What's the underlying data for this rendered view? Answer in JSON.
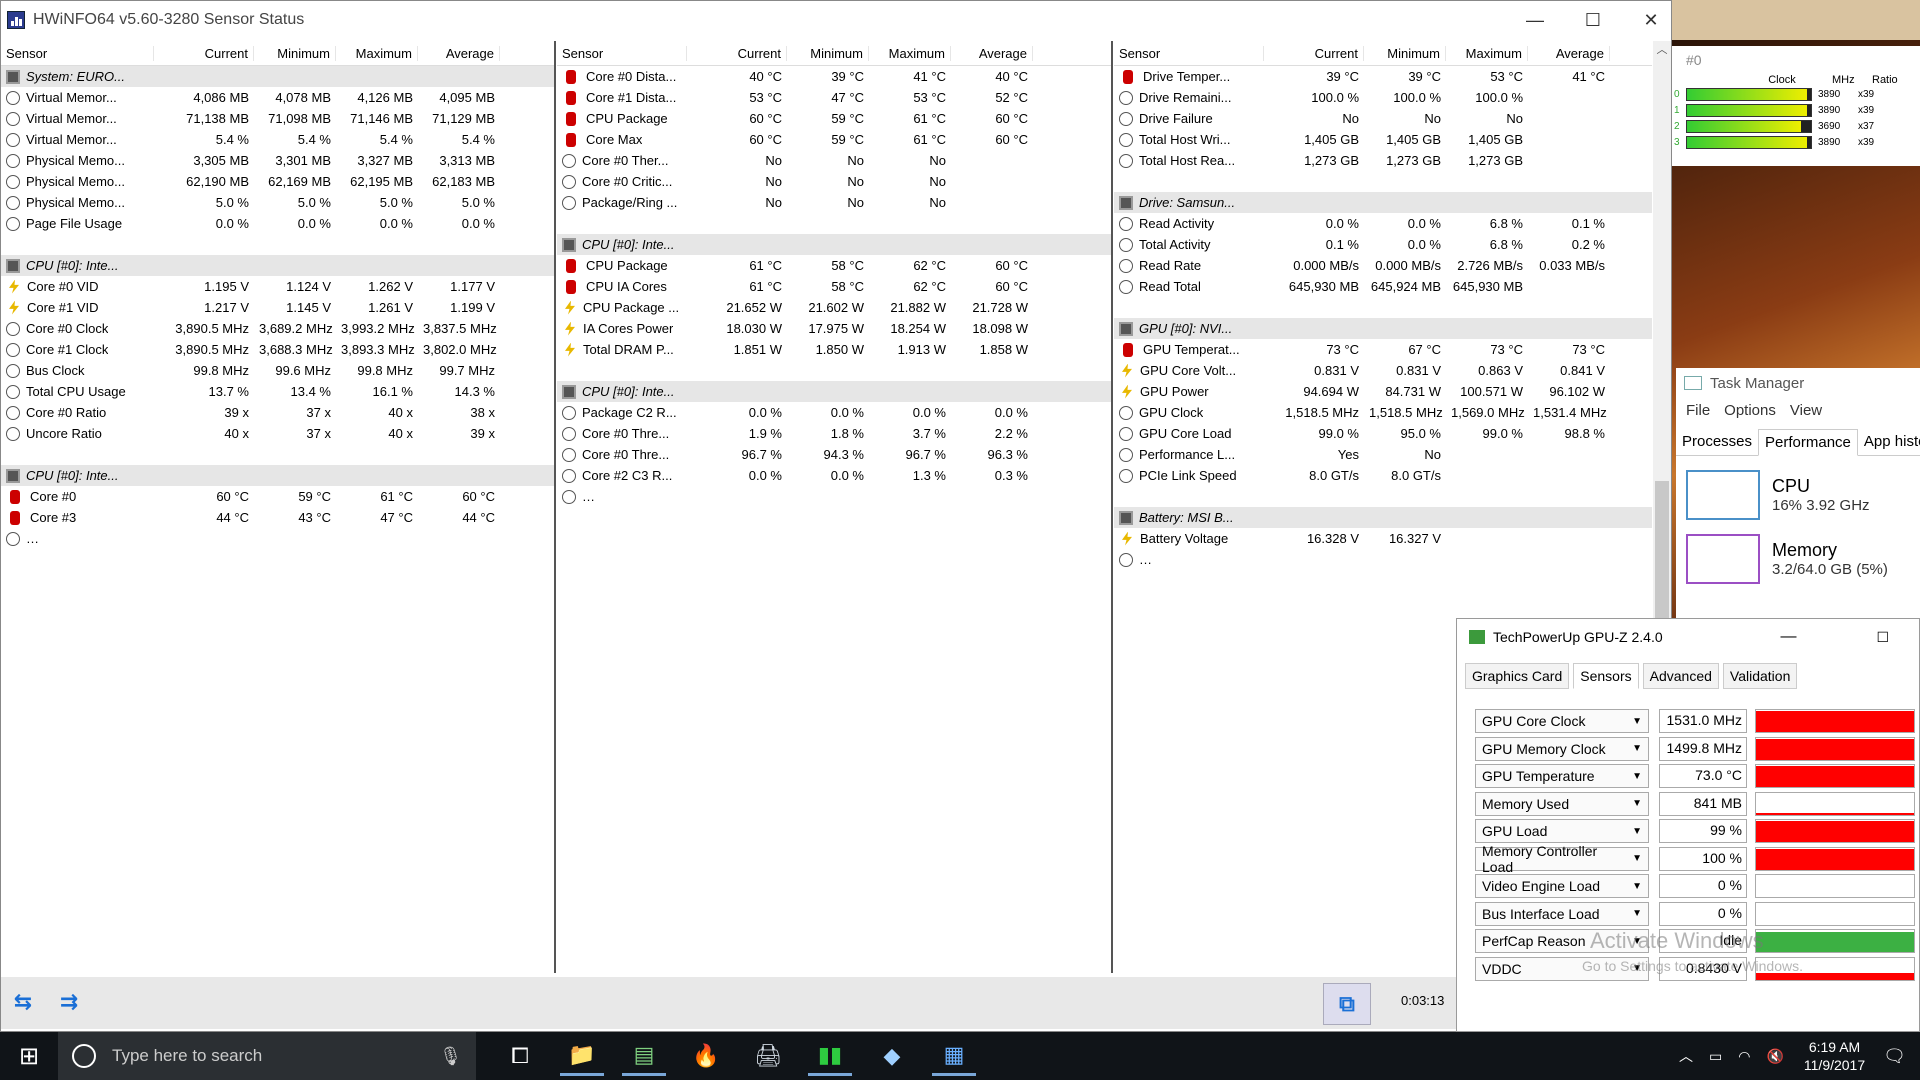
{
  "window": {
    "title": "HWiNFO64 v5.60-3280 Sensor Status",
    "min": "—",
    "max": "☐",
    "close": "✕"
  },
  "columns": [
    "Sensor",
    "Current",
    "Minimum",
    "Maximum",
    "Average"
  ],
  "panel1": [
    {
      "g": "System: EURO..."
    },
    {
      "i": "clock",
      "c": [
        "Virtual Memor...",
        "4,086 MB",
        "4,078 MB",
        "4,126 MB",
        "4,095 MB"
      ]
    },
    {
      "i": "clock",
      "c": [
        "Virtual Memor...",
        "71,138 MB",
        "71,098 MB",
        "71,146 MB",
        "71,129 MB"
      ]
    },
    {
      "i": "clock",
      "c": [
        "Virtual Memor...",
        "5.4 %",
        "5.4 %",
        "5.4 %",
        "5.4 %"
      ]
    },
    {
      "i": "clock",
      "c": [
        "Physical Memo...",
        "3,305 MB",
        "3,301 MB",
        "3,327 MB",
        "3,313 MB"
      ]
    },
    {
      "i": "clock",
      "c": [
        "Physical Memo...",
        "62,190 MB",
        "62,169 MB",
        "62,195 MB",
        "62,183 MB"
      ]
    },
    {
      "i": "clock",
      "c": [
        "Physical Memo...",
        "5.0 %",
        "5.0 %",
        "5.0 %",
        "5.0 %"
      ]
    },
    {
      "i": "clock",
      "c": [
        "Page File Usage",
        "0.0 %",
        "0.0 %",
        "0.0 %",
        "0.0 %"
      ]
    },
    {
      "b": 1
    },
    {
      "g": "CPU [#0]: Inte..."
    },
    {
      "i": "volt",
      "c": [
        "Core #0 VID",
        "1.195 V",
        "1.124 V",
        "1.262 V",
        "1.177 V"
      ]
    },
    {
      "i": "volt",
      "c": [
        "Core #1 VID",
        "1.217 V",
        "1.145 V",
        "1.261 V",
        "1.199 V"
      ]
    },
    {
      "i": "clock",
      "c": [
        "Core #0 Clock",
        "3,890.5 MHz",
        "3,689.2 MHz",
        "3,993.2 MHz",
        "3,837.5 MHz"
      ]
    },
    {
      "i": "clock",
      "c": [
        "Core #1 Clock",
        "3,890.5 MHz",
        "3,688.3 MHz",
        "3,893.3 MHz",
        "3,802.0 MHz"
      ]
    },
    {
      "i": "clock",
      "c": [
        "Bus Clock",
        "99.8 MHz",
        "99.6 MHz",
        "99.8 MHz",
        "99.7 MHz"
      ]
    },
    {
      "i": "clock",
      "c": [
        "Total CPU Usage",
        "13.7 %",
        "13.4 %",
        "16.1 %",
        "14.3 %"
      ]
    },
    {
      "i": "clock",
      "c": [
        "Core #0 Ratio",
        "39 x",
        "37 x",
        "40 x",
        "38 x"
      ]
    },
    {
      "i": "clock",
      "c": [
        "Uncore Ratio",
        "40 x",
        "37 x",
        "40 x",
        "39 x"
      ]
    },
    {
      "b": 1
    },
    {
      "g": "CPU [#0]: Inte..."
    },
    {
      "i": "therm",
      "c": [
        "Core #0",
        "60 °C",
        "59 °C",
        "61 °C",
        "60 °C"
      ]
    },
    {
      "i": "therm",
      "c": [
        "Core #3",
        "44 °C",
        "43 °C",
        "47 °C",
        "44 °C"
      ]
    },
    {
      "i": "clock",
      "c": [
        "…",
        "",
        "",
        "",
        ""
      ]
    }
  ],
  "panel2": [
    {
      "i": "therm",
      "c": [
        "Core #0 Dista...",
        "40 °C",
        "39 °C",
        "41 °C",
        "40 °C"
      ]
    },
    {
      "i": "therm",
      "c": [
        "Core #1 Dista...",
        "53 °C",
        "47 °C",
        "53 °C",
        "52 °C"
      ]
    },
    {
      "i": "therm",
      "c": [
        "CPU Package",
        "60 °C",
        "59 °C",
        "61 °C",
        "60 °C"
      ]
    },
    {
      "i": "therm",
      "c": [
        "Core Max",
        "60 °C",
        "59 °C",
        "61 °C",
        "60 °C"
      ]
    },
    {
      "i": "clock",
      "c": [
        "Core #0 Ther...",
        "No",
        "No",
        "No",
        ""
      ]
    },
    {
      "i": "clock",
      "c": [
        "Core #0 Critic...",
        "No",
        "No",
        "No",
        ""
      ]
    },
    {
      "i": "clock",
      "c": [
        "Package/Ring ...",
        "No",
        "No",
        "No",
        ""
      ]
    },
    {
      "b": 1
    },
    {
      "g": "CPU [#0]: Inte..."
    },
    {
      "i": "therm",
      "c": [
        "CPU Package",
        "61 °C",
        "58 °C",
        "62 °C",
        "60 °C"
      ]
    },
    {
      "i": "therm",
      "c": [
        "CPU IA Cores",
        "61 °C",
        "58 °C",
        "62 °C",
        "60 °C"
      ]
    },
    {
      "i": "volt",
      "c": [
        "CPU Package ...",
        "21.652 W",
        "21.602 W",
        "21.882 W",
        "21.728 W"
      ]
    },
    {
      "i": "volt",
      "c": [
        "IA Cores Power",
        "18.030 W",
        "17.975 W",
        "18.254 W",
        "18.098 W"
      ]
    },
    {
      "i": "volt",
      "c": [
        "Total DRAM P...",
        "1.851 W",
        "1.850 W",
        "1.913 W",
        "1.858 W"
      ]
    },
    {
      "b": 1
    },
    {
      "g": "CPU [#0]: Inte..."
    },
    {
      "i": "clock",
      "c": [
        "Package C2 R...",
        "0.0 %",
        "0.0 %",
        "0.0 %",
        "0.0 %"
      ]
    },
    {
      "i": "clock",
      "c": [
        "Core #0 Thre...",
        "1.9 %",
        "1.8 %",
        "3.7 %",
        "2.2 %"
      ]
    },
    {
      "i": "clock",
      "c": [
        "Core #0 Thre...",
        "96.7 %",
        "94.3 %",
        "96.7 %",
        "96.3 %"
      ]
    },
    {
      "i": "clock",
      "c": [
        "Core #2 C3 R...",
        "0.0 %",
        "0.0 %",
        "1.3 %",
        "0.3 %"
      ]
    },
    {
      "i": "clock",
      "c": [
        "…",
        "",
        "",
        "",
        ""
      ]
    }
  ],
  "panel3": [
    {
      "i": "therm",
      "c": [
        "Drive Temper...",
        "39 °C",
        "39 °C",
        "53 °C",
        "41 °C"
      ]
    },
    {
      "i": "clock",
      "c": [
        "Drive Remaini...",
        "100.0 %",
        "100.0 %",
        "100.0 %",
        ""
      ]
    },
    {
      "i": "clock",
      "c": [
        "Drive Failure",
        "No",
        "No",
        "No",
        ""
      ]
    },
    {
      "i": "clock",
      "c": [
        "Total Host Wri...",
        "1,405 GB",
        "1,405 GB",
        "1,405 GB",
        ""
      ]
    },
    {
      "i": "clock",
      "c": [
        "Total Host Rea...",
        "1,273 GB",
        "1,273 GB",
        "1,273 GB",
        ""
      ]
    },
    {
      "b": 1
    },
    {
      "g": "Drive: Samsun..."
    },
    {
      "i": "clock",
      "c": [
        "Read Activity",
        "0.0 %",
        "0.0 %",
        "6.8 %",
        "0.1 %"
      ]
    },
    {
      "i": "clock",
      "c": [
        "Total Activity",
        "0.1 %",
        "0.0 %",
        "6.8 %",
        "0.2 %"
      ]
    },
    {
      "i": "clock",
      "c": [
        "Read Rate",
        "0.000 MB/s",
        "0.000 MB/s",
        "2.726 MB/s",
        "0.033 MB/s"
      ]
    },
    {
      "i": "clock",
      "c": [
        "Read Total",
        "645,930 MB",
        "645,924 MB",
        "645,930 MB",
        ""
      ]
    },
    {
      "b": 1
    },
    {
      "g": "GPU [#0]: NVI..."
    },
    {
      "i": "therm",
      "c": [
        "GPU Temperat...",
        "73 °C",
        "67 °C",
        "73 °C",
        "73 °C"
      ]
    },
    {
      "i": "volt",
      "c": [
        "GPU Core Volt...",
        "0.831 V",
        "0.831 V",
        "0.863 V",
        "0.841 V"
      ]
    },
    {
      "i": "volt",
      "c": [
        "GPU Power",
        "94.694 W",
        "84.731 W",
        "100.571 W",
        "96.102 W"
      ]
    },
    {
      "i": "clock",
      "c": [
        "GPU Clock",
        "1,518.5 MHz",
        "1,518.5 MHz",
        "1,569.0 MHz",
        "1,531.4 MHz"
      ]
    },
    {
      "i": "clock",
      "c": [
        "GPU Core Load",
        "99.0 %",
        "95.0 %",
        "99.0 %",
        "98.8 %"
      ]
    },
    {
      "i": "clock",
      "c": [
        "Performance L...",
        "Yes",
        "No",
        "",
        ""
      ]
    },
    {
      "i": "clock",
      "c": [
        "PCIe Link Speed",
        "8.0 GT/s",
        "8.0 GT/s",
        "",
        ""
      ]
    },
    {
      "b": 1
    },
    {
      "g": "Battery: MSI B..."
    },
    {
      "i": "volt",
      "c": [
        "Battery Voltage",
        "16.328 V",
        "16.327 V",
        "",
        ""
      ]
    },
    {
      "i": "clock",
      "c": [
        "…",
        "",
        "",
        "",
        ""
      ]
    }
  ],
  "status": {
    "elapsed": "0:03:13"
  },
  "clocks_widget": {
    "title": "#0",
    "headers": [
      "Clock",
      "MHz",
      "Ratio"
    ],
    "rows": [
      {
        "core": "0",
        "mhz": "3890",
        "ratio": "x39",
        "level": 0.97
      },
      {
        "core": "1",
        "mhz": "3890",
        "ratio": "x39",
        "level": 0.97
      },
      {
        "core": "2",
        "mhz": "3690",
        "ratio": "x37",
        "level": 0.92
      },
      {
        "core": "3",
        "mhz": "3890",
        "ratio": "x39",
        "level": 0.97
      }
    ]
  },
  "task_manager": {
    "title": "Task Manager",
    "menu": [
      "File",
      "Options",
      "View"
    ],
    "tabs": [
      "Processes",
      "Performance",
      "App histor"
    ],
    "cpu": {
      "label": "CPU",
      "value": "16% 3.92 GHz"
    },
    "memory": {
      "label": "Memory",
      "value": "3.2/64.0 GB (5%)"
    }
  },
  "gpuz": {
    "title": "TechPowerUp GPU-Z 2.4.0",
    "tabs": [
      "Graphics Card",
      "Sensors",
      "Advanced",
      "Validation"
    ],
    "sensors": [
      {
        "name": "GPU Core Clock",
        "value": "1531.0 MHz",
        "level": 0.95,
        "color": "#ff0000"
      },
      {
        "name": "GPU Memory Clock",
        "value": "1499.8 MHz",
        "level": 0.95,
        "color": "#ff0000"
      },
      {
        "name": "GPU Temperature",
        "value": "73.0 °C",
        "level": 0.95,
        "color": "#ff0000"
      },
      {
        "name": "Memory Used",
        "value": "841 MB",
        "level": 0.05,
        "color": "#ff0000"
      },
      {
        "name": "GPU Load",
        "value": "99 %",
        "level": 0.95,
        "color": "#ff0000"
      },
      {
        "name": "Memory Controller Load",
        "value": "100 %",
        "level": 0.95,
        "color": "#ff0000"
      },
      {
        "name": "Video Engine Load",
        "value": "0 %",
        "level": 0,
        "color": "#ff0000"
      },
      {
        "name": "Bus Interface Load",
        "value": "0 %",
        "level": 0,
        "color": "#ff0000"
      },
      {
        "name": "PerfCap Reason",
        "value": "Idle",
        "level": 0.9,
        "color": "#3cb043"
      },
      {
        "name": "VDDC",
        "value": "0.8430 V",
        "level": 0.3,
        "color": "#ff0000"
      }
    ]
  },
  "watermark": {
    "line1": "Activate Windows",
    "line2": "Go to Settings to activate Windows."
  },
  "taskbar": {
    "search_placeholder": "Type here to search",
    "time": "6:19 AM",
    "date": "11/9/2017"
  }
}
